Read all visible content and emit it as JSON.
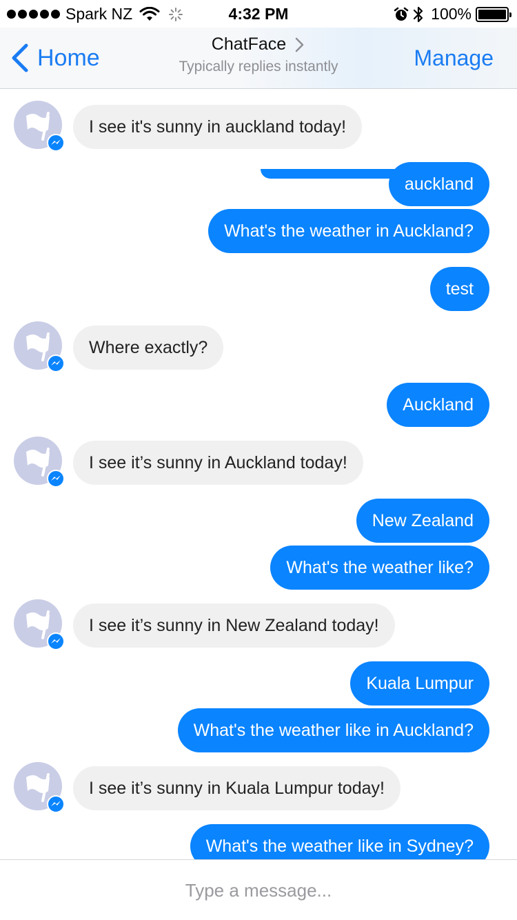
{
  "status_bar": {
    "carrier": "Spark NZ",
    "time": "4:32 PM",
    "battery": "100%",
    "icons": [
      "signal-dots",
      "wifi-icon",
      "spinner-icon",
      "alarm-icon",
      "bluetooth-icon",
      "battery-icon"
    ]
  },
  "nav": {
    "back_label": "Home",
    "title": "ChatFace",
    "subtitle": "Typically replies instantly",
    "manage_label": "Manage"
  },
  "colors": {
    "accent": "#1a7cf2",
    "outgoing_bubble": "#0a84ff",
    "incoming_bubble": "#f0f0f0",
    "avatar_bg": "#c9cde6"
  },
  "messages": [
    {
      "dir": "in",
      "text": "I see it's sunny in auckland today!"
    },
    {
      "dir": "out",
      "text": "auckland"
    },
    {
      "dir": "out",
      "text": "What's the weather in Auckland?"
    },
    {
      "dir": "out",
      "text": "test"
    },
    {
      "dir": "in",
      "text": "Where exactly?"
    },
    {
      "dir": "out",
      "text": "Auckland"
    },
    {
      "dir": "in",
      "text": "I see it’s sunny in Auckland today!"
    },
    {
      "dir": "out",
      "text": "New Zealand"
    },
    {
      "dir": "out",
      "text": "What's the weather like?"
    },
    {
      "dir": "in",
      "text": "I see it’s sunny in New Zealand today!"
    },
    {
      "dir": "out",
      "text": "Kuala Lumpur"
    },
    {
      "dir": "out",
      "text": "What's the weather like in Auckland?"
    },
    {
      "dir": "in",
      "text": "I see it’s sunny in Kuala Lumpur today!"
    },
    {
      "dir": "out",
      "text": "What's the weather like in Sydney?"
    }
  ],
  "composer": {
    "placeholder": "Type a message..."
  }
}
